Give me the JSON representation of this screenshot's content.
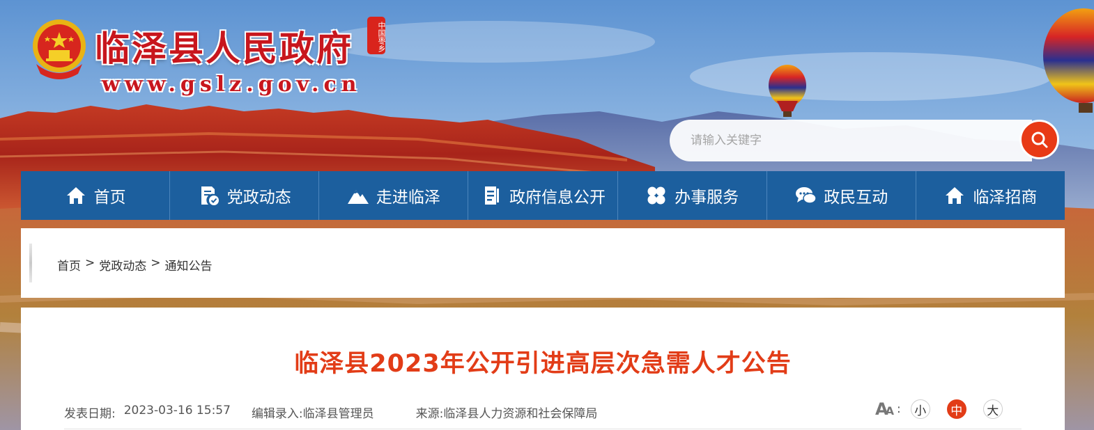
{
  "header": {
    "site_title": "临泽县人民政府",
    "seal_text": "中国枣乡",
    "site_url": "www.gslz.gov.cn",
    "emblem_icon": "national-emblem-icon"
  },
  "search": {
    "placeholder": "请输入关键字",
    "button_icon": "search-icon",
    "button_color": "#e83a16"
  },
  "nav": {
    "background": "#1c5f9e",
    "items": [
      {
        "label": "首页",
        "icon": "home-icon"
      },
      {
        "label": "党政动态",
        "icon": "document-check-icon"
      },
      {
        "label": "走进临泽",
        "icon": "mountain-icon"
      },
      {
        "label": "政府信息公开",
        "icon": "document-list-icon"
      },
      {
        "label": "办事服务",
        "icon": "grid-clover-icon"
      },
      {
        "label": "政民互动",
        "icon": "chat-bubbles-icon"
      },
      {
        "label": "临泽招商",
        "icon": "home-icon"
      }
    ]
  },
  "breadcrumb": {
    "items": [
      "首页",
      "党政动态",
      "通知公告"
    ],
    "separator": ">"
  },
  "article": {
    "title": "临泽县2023年公开引进高层次急需人才公告",
    "title_color": "#e23c17",
    "meta": {
      "date_label": "发表日期:",
      "date_value": "2023-03-16 15:57",
      "editor_label": "编辑录入:",
      "editor_value": "临泽县管理员",
      "source_label": "来源:",
      "source_value": "临泽县人力资源和社会保障局"
    },
    "font_size": {
      "icon": "font-size-icon",
      "colon": ":",
      "options": [
        "小",
        "中",
        "大"
      ],
      "selected": "中"
    }
  }
}
